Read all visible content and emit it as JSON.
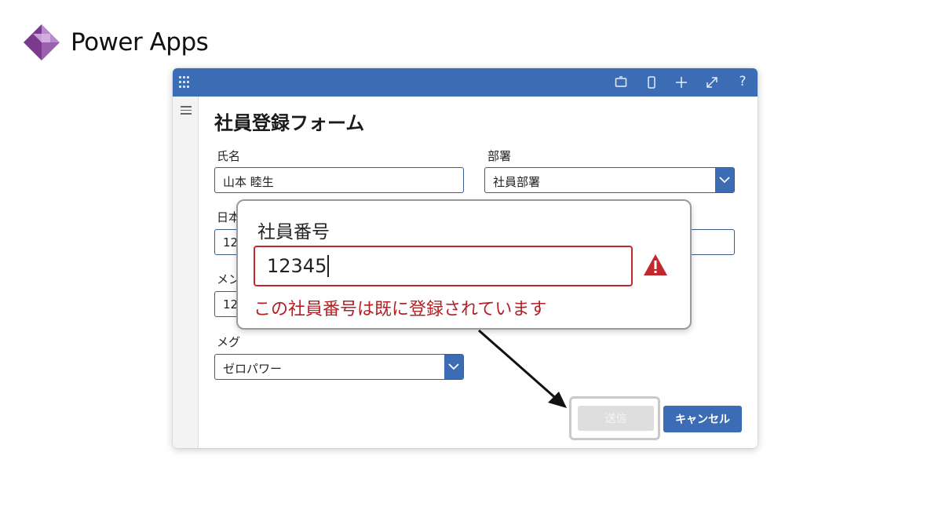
{
  "brand": {
    "title": "Power Apps",
    "logo_icon": "power-apps-logo",
    "accent": "#7a3b8f"
  },
  "titlebar": {
    "background": "#3c6cb4",
    "icons": [
      "waffle-icon",
      "tablet-icon",
      "phone-icon",
      "plus-icon",
      "expand-icon",
      "help-icon"
    ],
    "help_glyph": "?"
  },
  "form": {
    "title": "社員登録フォーム",
    "name": {
      "label": "氏名",
      "value": "山本 睦生"
    },
    "department": {
      "label": "部署",
      "value": "社員部署"
    },
    "hidden_label_1": "日本",
    "hidden_value_1": "12",
    "hidden_label_2": "メン",
    "hidden_value_2": "12",
    "meg": {
      "label": "メグ",
      "value": "ゼロパワー"
    },
    "send_label": "送信",
    "cancel_label": "キャンセル"
  },
  "popup": {
    "label": "社員番号",
    "value": "12345",
    "error": "この社員番号は既に登録されています",
    "error_color": "#b32025",
    "warning_icon": "warning-triangle-icon"
  }
}
